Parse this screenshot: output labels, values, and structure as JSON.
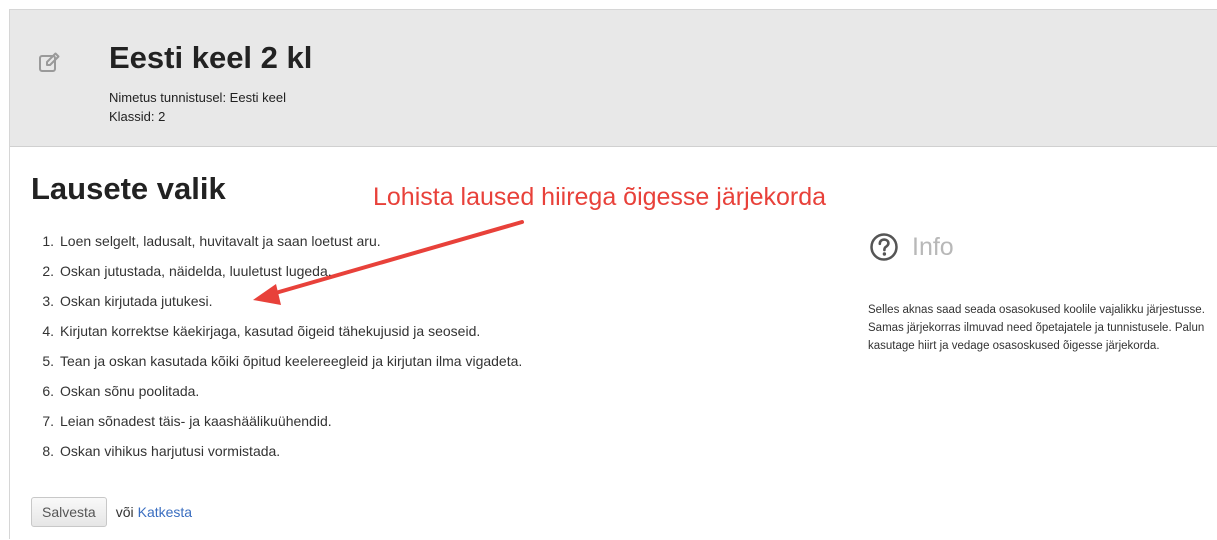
{
  "header": {
    "icon": "edit-icon",
    "title": "Eesti keel 2 kl",
    "name_line": "Nimetus tunnistusel: Eesti keel",
    "classes_line": "Klassid: 2"
  },
  "section": {
    "title": "Lausete valik"
  },
  "annotation": {
    "text": "Lohista laused hiirega õigesse järjekorda",
    "color": "#e8413a"
  },
  "sentences": [
    {
      "num": "1.",
      "text": "Loen selgelt, ladusalt, huvitavalt ja saan loetust aru."
    },
    {
      "num": "2.",
      "text": "Oskan jutustada, näidelda, luuletust lugeda."
    },
    {
      "num": "3.",
      "text": "Oskan kirjutada jutukesi."
    },
    {
      "num": "4.",
      "text": "Kirjutan korrektse käekirjaga, kasutad õigeid tähekujusid ja seoseid."
    },
    {
      "num": "5.",
      "text": "Tean ja oskan kasutada kõiki õpitud keelereegleid ja kirjutan ilma vigadeta."
    },
    {
      "num": "6.",
      "text": "Oskan sõnu poolitada."
    },
    {
      "num": "7.",
      "text": "Leian sõnadest täis- ja kaashäälikuühendid."
    },
    {
      "num": "8.",
      "text": "Oskan vihikus harjutusi vormistada."
    }
  ],
  "info": {
    "icon": "question-circle-icon",
    "title": "Info",
    "text": "Selles aknas saad seada osasokused koolile vajalikku järjestusse. Samas järjekorras ilmuvad need õpetajatele ja tunnistusele. Palun kasutage hiirt ja vedage osasoskused õigesse järjekorda."
  },
  "actions": {
    "save_label": "Salvesta",
    "or_text": "või",
    "cancel_label": "Katkesta"
  },
  "colors": {
    "header_bg": "#e8e8e8",
    "link": "#3a6ec0",
    "info_muted": "#b8b8b8"
  }
}
